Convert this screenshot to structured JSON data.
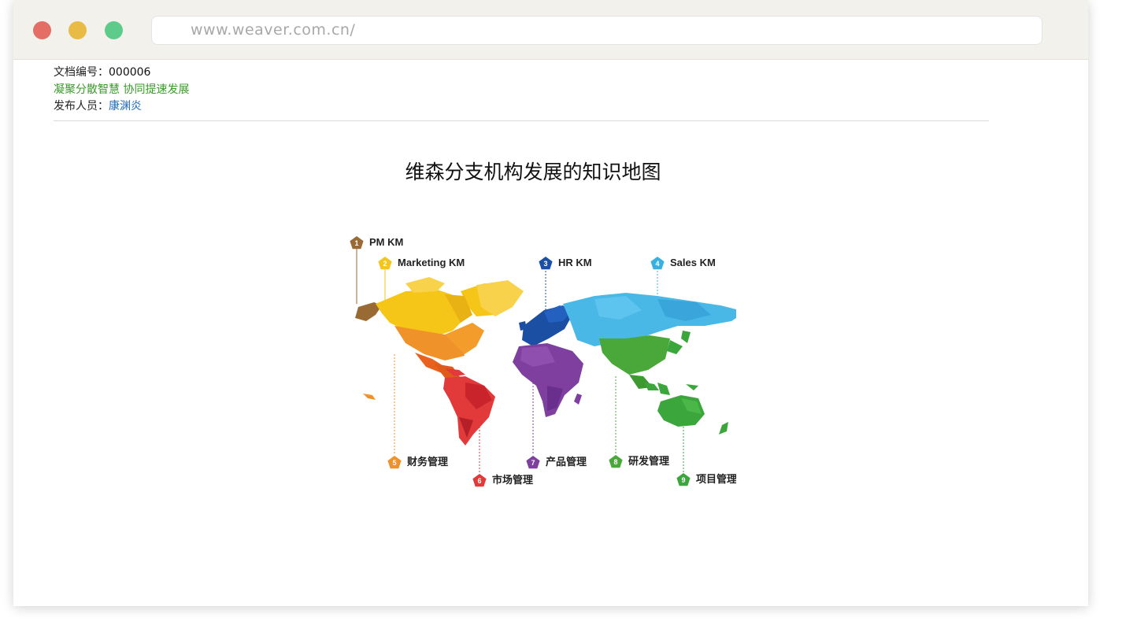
{
  "browser": {
    "url": "www.weaver.com.cn/"
  },
  "document": {
    "number_label": "文档编号：",
    "number_value": "000006",
    "slogan": "凝聚分散智慧 协同提速发展",
    "publisher_label": "发布人员：",
    "publisher_name": "康渊炎",
    "title": "维森分支机构发展的知识地图"
  },
  "knowledge_map": {
    "items": [
      {
        "number": "1",
        "label": "PM KM",
        "color": "#9a6a35"
      },
      {
        "number": "2",
        "label": "Marketing KM",
        "color": "#f2c61c"
      },
      {
        "number": "3",
        "label": "HR KM",
        "color": "#1b4fa3"
      },
      {
        "number": "4",
        "label": "Sales KM",
        "color": "#3ab0e0"
      },
      {
        "number": "5",
        "label": "财务管理",
        "color": "#f0922a"
      },
      {
        "number": "6",
        "label": "市场管理",
        "color": "#e23a3a"
      },
      {
        "number": "7",
        "label": "产品管理",
        "color": "#7e3f9f"
      },
      {
        "number": "8",
        "label": "研发管理",
        "color": "#4aa83a"
      },
      {
        "number": "9",
        "label": "项目管理",
        "color": "#3aa63c"
      }
    ]
  }
}
